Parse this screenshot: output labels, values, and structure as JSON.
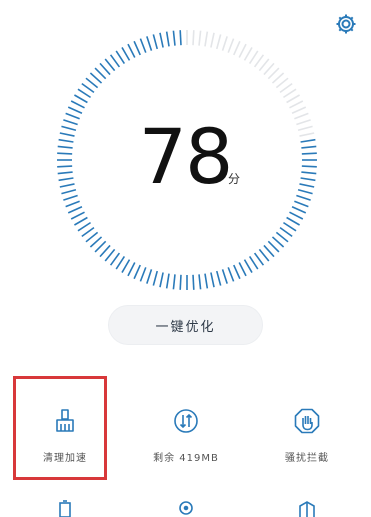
{
  "header": {
    "settings_icon": "gear-icon"
  },
  "gauge": {
    "score": "78",
    "unit": "分",
    "progress": 0.78,
    "accent_color": "#2a7ab9"
  },
  "optimize_button": {
    "label": "一键优化"
  },
  "tiles": [
    {
      "icon": "broom-icon",
      "label": "清理加速"
    },
    {
      "icon": "data-arrows-icon",
      "label": "剩余 419MB"
    },
    {
      "icon": "stop-hand-icon",
      "label": "骚扰拦截"
    }
  ],
  "highlight_color": "#d8383a",
  "bottom_row_icons": [
    "battery-icon",
    "pin-icon",
    "app-icon"
  ]
}
